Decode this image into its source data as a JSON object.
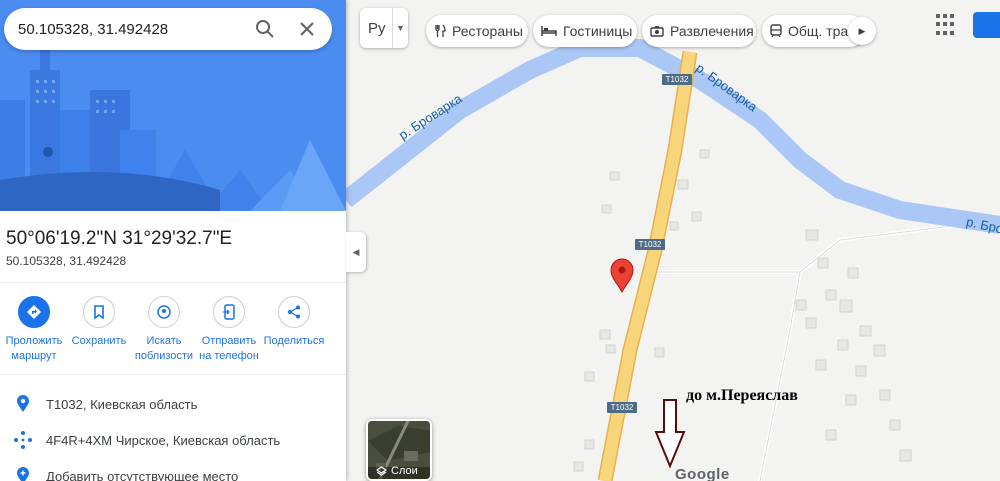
{
  "search": {
    "value": "50.105328, 31.492428"
  },
  "place": {
    "title": "50°06'19.2\"N 31°29'32.7\"E",
    "subtitle": "50.105328, 31.492428"
  },
  "actions": [
    {
      "label": "Проложить маршрут",
      "icon": "directions-icon"
    },
    {
      "label": "Сохранить",
      "icon": "bookmark-icon"
    },
    {
      "label": "Искать поблизости",
      "icon": "nearby-icon"
    },
    {
      "label": "Отправить на телефон",
      "icon": "send-to-phone-icon"
    },
    {
      "label": "Поделиться",
      "icon": "share-icon"
    }
  ],
  "info": [
    {
      "text": "T1032, Киевская область",
      "icon": "location-pin-icon"
    },
    {
      "text": "4F4R+4XM Чирское, Киевская область",
      "icon": "plus-code-icon"
    },
    {
      "text": "Добавить отсутствующее место",
      "icon": "add-place-icon"
    }
  ],
  "topbar": {
    "lang": "Ру",
    "chips": [
      "Рестораны",
      "Гостиницы",
      "Развлечения",
      "Общ. тран"
    ]
  },
  "map": {
    "river_label_1": "р. Броварка",
    "river_label_2": "р. Броварка",
    "river_label_3": "р. Бров",
    "road_labels": [
      "T1032",
      "T1032",
      "T1032"
    ],
    "layers_label": "Слои",
    "annotation": "до м.Переяслав",
    "logo": "Google"
  },
  "colors": {
    "accent": "#1a73e8",
    "river": "#aac7f5",
    "road": "#f8c964",
    "pin": "#ea4335",
    "arrow": "#5a0c0c"
  }
}
